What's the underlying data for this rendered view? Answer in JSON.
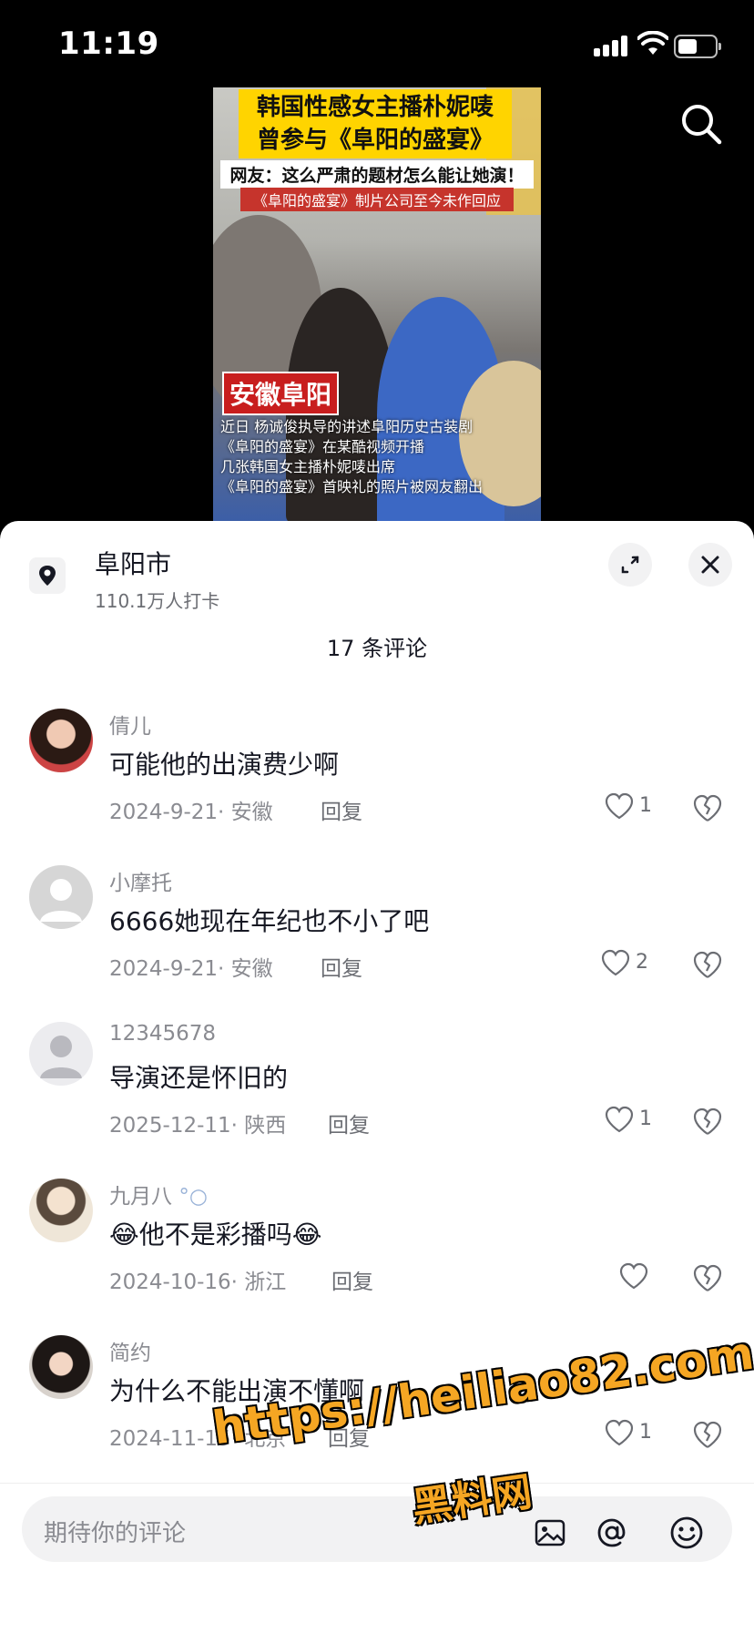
{
  "status_bar": {
    "time": "11:19"
  },
  "video": {
    "title_line1": "韩国性感女主播朴妮唛",
    "title_line2": "曾参与《阜阳的盛宴》",
    "subtitle": "网友：这么严肃的题材怎么能让她演！",
    "subtitle2": "《阜阳的盛宴》制片公司至今未作回应",
    "location_tag": "安徽阜阳",
    "captions": [
      "近日 杨诚俊执导的讲述阜阳历史古装剧",
      "《阜阳的盛宴》在某酷视频开播",
      "几张韩国女主播朴妮唛出席",
      "《阜阳的盛宴》首映礼的照片被网友翻出"
    ]
  },
  "location": {
    "name": "阜阳市",
    "checkins": "110.1万人打卡"
  },
  "comment_count": "17 条评论",
  "comments": [
    {
      "user": "倩儿",
      "text": "可能他的出演费少啊",
      "date": "2024-9-21",
      "region": "安徽",
      "reply": "回复",
      "likes": "1"
    },
    {
      "user": "小摩托",
      "text": "6666她现在年纪也不小了吧",
      "date": "2024-9-21",
      "region": "安徽",
      "reply": "回复",
      "likes": "2"
    },
    {
      "user": "12345678",
      "text": "导演还是怀旧的",
      "date": "2025-12-11",
      "region": "陕西",
      "reply": "回复",
      "likes": "1"
    },
    {
      "user": "九月八",
      "text": "他不是彩播吗",
      "date": "2024-10-16",
      "region": "浙江",
      "reply": "回复",
      "likes": ""
    },
    {
      "user": "简约",
      "text": "为什么不能出演不懂啊",
      "date": "2024-11-15",
      "region": "北京",
      "reply": "回复",
      "likes": "1"
    }
  ],
  "comment_input": {
    "placeholder": "期待你的评论"
  },
  "watermark": {
    "line1": "https://heiliao82.com",
    "line2": "黑料网"
  },
  "colors": {
    "accent_text": "#161823",
    "muted": "#8a8b91",
    "watermark": "#f5a623"
  }
}
